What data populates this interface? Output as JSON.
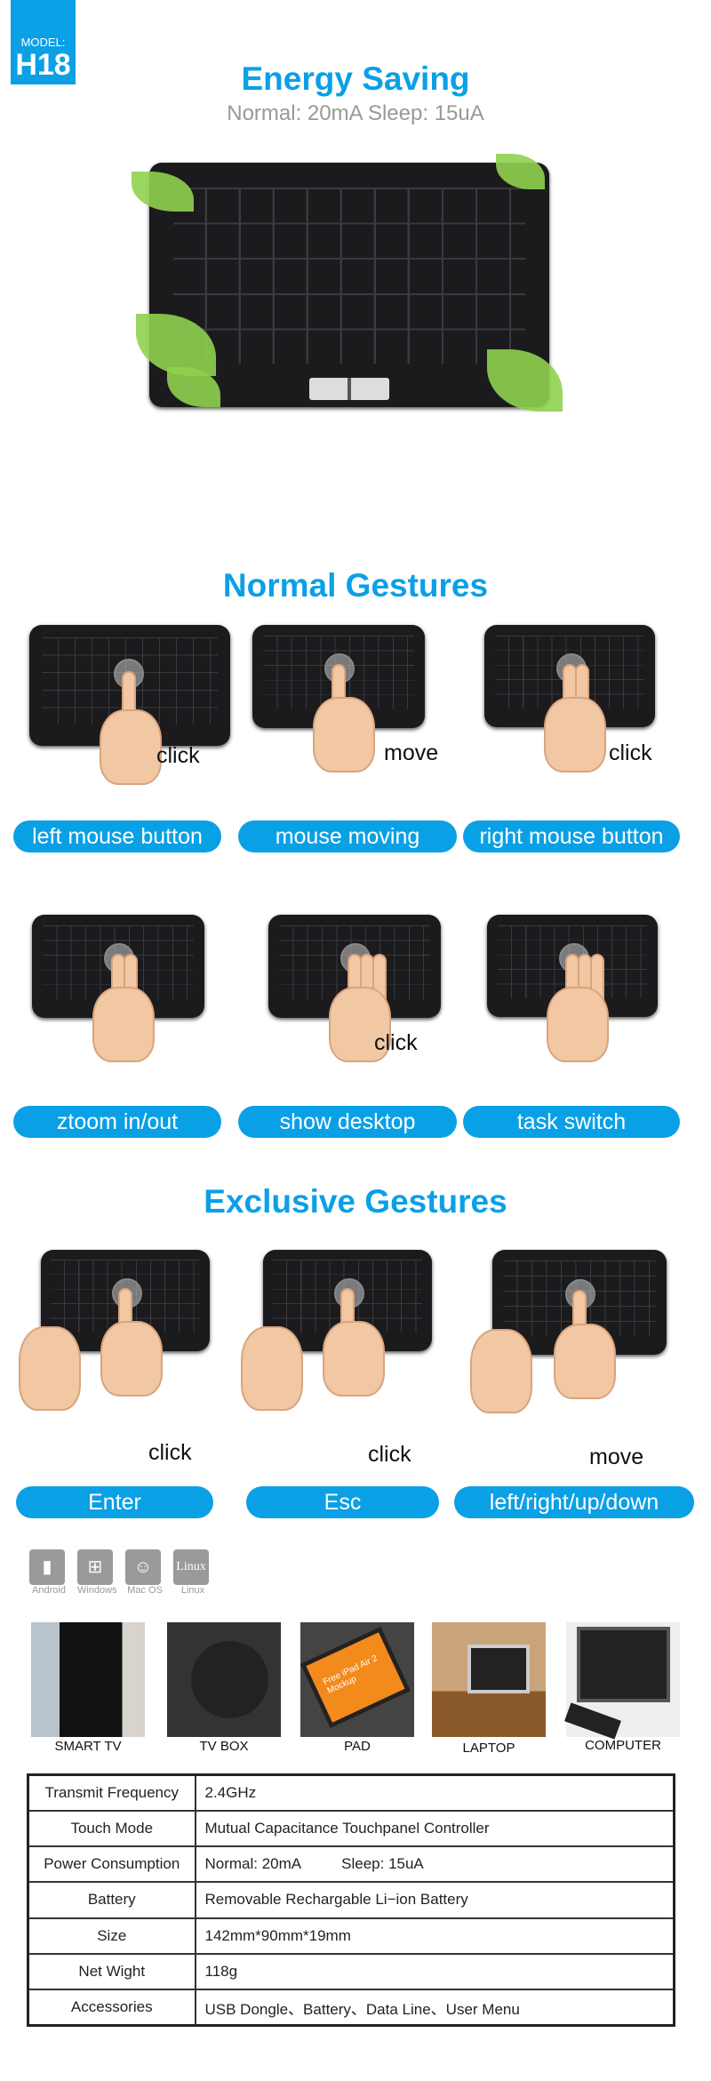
{
  "badge": {
    "model_label": "MODEL:",
    "model": "H18"
  },
  "energy": {
    "title": "Energy Saving",
    "subtitle": "Normal: 20mA  Sleep: 15uA"
  },
  "normal": {
    "title": "Normal Gestures",
    "items": [
      {
        "label": "left mouse button",
        "action": "click"
      },
      {
        "label": "mouse moving",
        "action": "move"
      },
      {
        "label": "right mouse button",
        "action": "click"
      },
      {
        "label": "ztoom in/out",
        "action": ""
      },
      {
        "label": "show desktop",
        "action": "click"
      },
      {
        "label": "task switch",
        "action": ""
      }
    ]
  },
  "exclusive": {
    "title": "Exclusive Gestures",
    "items": [
      {
        "label": "Enter",
        "action": "click"
      },
      {
        "label": "Esc",
        "action": "click"
      },
      {
        "label": "left/right/up/down",
        "action": "move"
      }
    ]
  },
  "os": [
    {
      "name": "Android",
      "icon": "android-icon"
    },
    {
      "name": "Windows",
      "icon": "windows-icon"
    },
    {
      "name": "Mac OS",
      "icon": "finder-icon"
    },
    {
      "name": "Linux",
      "icon": "linux-icon",
      "glyph": "Linux"
    }
  ],
  "devices": [
    "SMART TV",
    "TV BOX",
    "PAD",
    "LAPTOP",
    "COMPUTER"
  ],
  "pad_screen_text": "Free iPad Air 2 Mockup",
  "specs": [
    {
      "k": "Transmit Frequency",
      "v": "2.4GHz"
    },
    {
      "k": "Touch Mode",
      "v": "Mutual Capacitance Touchpanel Controller"
    },
    {
      "k": "Power Consumption",
      "v": "Normal: 20mA",
      "v2": "Sleep: 15uA"
    },
    {
      "k": "Battery",
      "v": "Removable Rechargable Li−ion Battery"
    },
    {
      "k": "Size",
      "v": "142mm*90mm*19mm"
    },
    {
      "k": "Net Wight",
      "v": "118g"
    },
    {
      "k": "Accessories",
      "v": "USB Dongle、Battery、Data Line、User Menu"
    }
  ],
  "colors": {
    "accent": "#0aa0e6"
  }
}
